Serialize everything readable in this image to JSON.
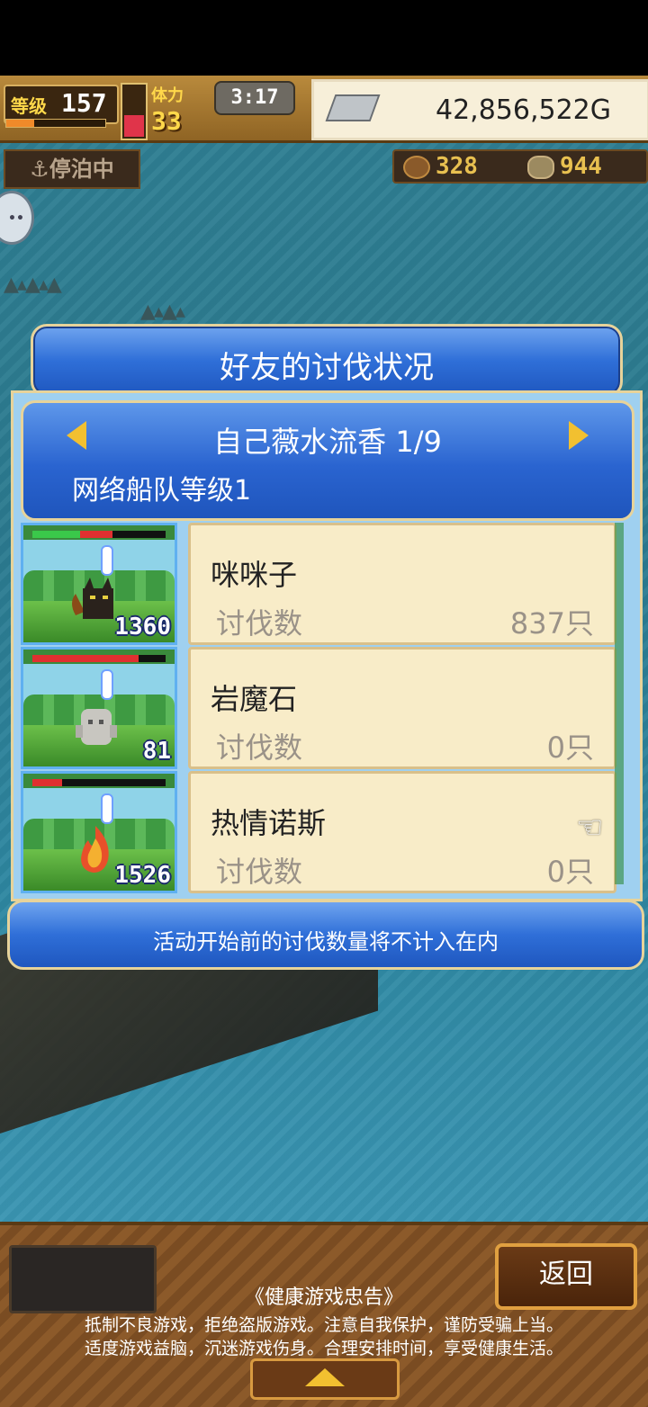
{
  "hud": {
    "level_label": "等级",
    "level_value": "157",
    "stamina_label": "体力",
    "stamina_value": "33",
    "clock": "3:17",
    "gold": "42,856,522G",
    "status": "⚓停泊中",
    "resource_1": "328",
    "resource_2": "944"
  },
  "dialog": {
    "title": "好友的讨伐状况",
    "friend_name": "自己薇水流香 1/9",
    "fleet_level": "网络船队等级1",
    "rows": [
      {
        "name": "咪咪子",
        "kill_label": "讨伐数",
        "kill_value": "837只",
        "thumb_count": "1360",
        "hp_colors": [
          "#3ac84a",
          "#e03030"
        ]
      },
      {
        "name": "岩魔石",
        "kill_label": "讨伐数",
        "kill_value": "0只",
        "thumb_count": "81",
        "hp_colors": [
          "#e03030"
        ]
      },
      {
        "name": "热情诺斯",
        "kill_label": "讨伐数",
        "kill_value": "0只",
        "thumb_count": "1526",
        "hp_colors": [
          "#e03030"
        ]
      }
    ],
    "notice": "活动开始前的讨伐数量将不计入在内"
  },
  "footer": {
    "back_label": "返回",
    "advice_title": "《健康游戏忠告》",
    "advice_line1": "抵制不良游戏，拒绝盗版游戏。注意自我保护，谨防受骗上当。",
    "advice_line2": "适度游戏益脑，沉迷游戏伤身。合理安排时间，享受健康生活。"
  },
  "colors": {
    "dialog_blue": "#2f6fd8",
    "gold_trim": "#e7d39a",
    "card_bg": "#f8ecc8"
  }
}
